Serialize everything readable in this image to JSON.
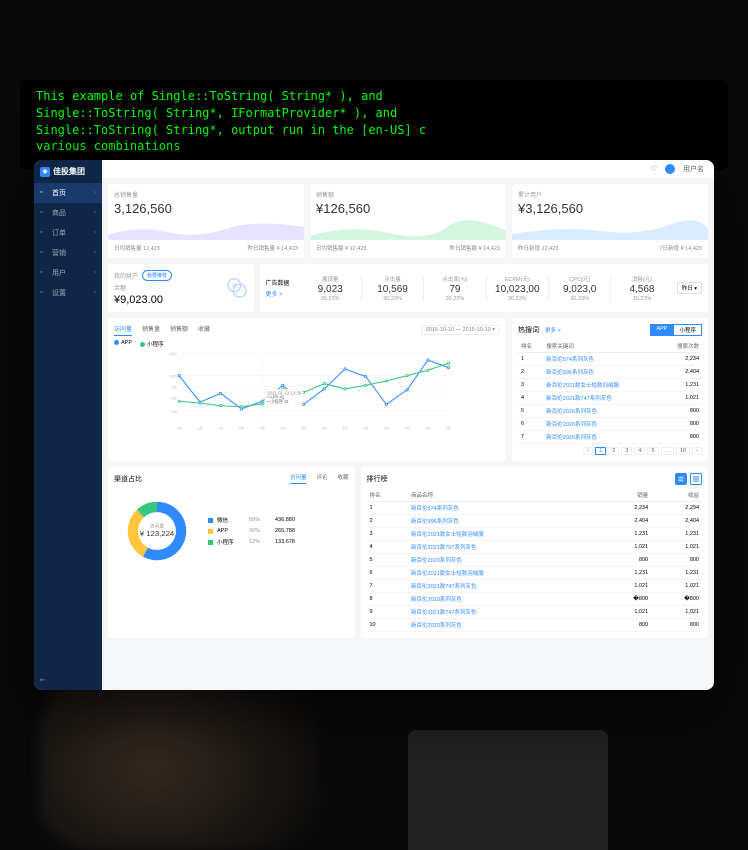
{
  "terminal": {
    "line1": "This example of Single::ToString( String* ), and",
    "line2": "Single::ToString( String*, IFormatProvider* ), and",
    "line3": "Single::ToString( String*, output run in the [en-US] c",
    "line4": "various combinations"
  },
  "brand": "佳投集团",
  "topbar": {
    "user": "用户名"
  },
  "nav": [
    {
      "label": "首页",
      "active": true
    },
    {
      "label": "商品",
      "active": false
    },
    {
      "label": "订单",
      "active": false
    },
    {
      "label": "营销",
      "active": false
    },
    {
      "label": "用户",
      "active": false
    },
    {
      "label": "设置",
      "active": false
    }
  ],
  "kpis": [
    {
      "label": "总销售量",
      "value": "3,126,560",
      "footLeft": "日均销售量 12,423",
      "footRight": "昨日销售量 ¥ 14,423",
      "color": "#e6e2ff"
    },
    {
      "label": "销售额",
      "value": "¥126,560",
      "footLeft": "日均销售额 ¥ 12,423",
      "footRight": "昨日销售额 ¥ 14,423",
      "color": "#d4f5df"
    },
    {
      "label": "累计用户",
      "value": "¥3,126,560",
      "footLeft": "昨日新增 12,423",
      "footRight": "7日新增 ¥ 14,423",
      "color": "#d8ecff"
    }
  ],
  "wallet": {
    "title": "我的财产",
    "btn": "我要推荐",
    "label": "余额",
    "value": "¥9,023.00"
  },
  "ad": {
    "title": "广告数据",
    "more": "更多 >",
    "select": "昨日 ▾",
    "metrics": [
      {
        "name": "展现量",
        "val": "9,023",
        "delta": "30.23%"
      },
      {
        "name": "点击量",
        "val": "10,569",
        "delta": "30.23%"
      },
      {
        "name": "点击率(%)",
        "val": "79",
        "delta": "30.23%"
      },
      {
        "name": "ECPM(元)",
        "val": "10,023,00",
        "delta": "30.23%"
      },
      {
        "name": "CPC(元)",
        "val": "9,023,0",
        "delta": "30.23%"
      },
      {
        "name": "消耗(元)",
        "val": "4,568",
        "delta": "30.23%"
      }
    ]
  },
  "chart": {
    "tabs": [
      "访问量",
      "销售量",
      "销售额",
      "收藏"
    ],
    "dateRange": "2015-10-10 — 2015-10-10 ▾",
    "legend": [
      {
        "name": "APP",
        "color": "#2e8bff"
      },
      {
        "name": "小程序",
        "color": "#32c77c"
      }
    ],
    "tooltip": {
      "date": "2021-01-12 12:30",
      "l1": "APP  42",
      "l2": "小程序  31"
    },
    "chart_data": {
      "type": "line",
      "title": "",
      "xlabel": "",
      "ylabel": "",
      "ylim": [
        0,
        1500
      ],
      "yticks": [
        200,
        500,
        750,
        1000,
        1500
      ],
      "categories": [
        "1月",
        "1月",
        "1月",
        "2月",
        "2月",
        "2月",
        "2月",
        "3月",
        "3月",
        "3月",
        "3月",
        "4月",
        "4月",
        "4月"
      ],
      "series": [
        {
          "name": "APP",
          "color": "#2e8bff",
          "values": [
            1000,
            400,
            600,
            250,
            420,
            780,
            350,
            700,
            1150,
            980,
            350,
            680,
            1350,
            1180
          ]
        },
        {
          "name": "小程序",
          "color": "#32c77c",
          "values": [
            420,
            380,
            320,
            300,
            360,
            700,
            620,
            820,
            700,
            780,
            880,
            1000,
            1120,
            1280
          ]
        }
      ]
    }
  },
  "search": {
    "title": "热搜词",
    "more": "更多 >",
    "segs": [
      "APP",
      "小程序"
    ],
    "cols": [
      "排名",
      "搜索关键词",
      "搜索次数"
    ],
    "rows": [
      {
        "r": "1",
        "k": "新百伦574系列灰色",
        "c": "2,234"
      },
      {
        "r": "2",
        "k": "新百伦996系列灰色",
        "c": "2,404"
      },
      {
        "r": "3",
        "k": "新百伦2021款女士短款羽绒服",
        "c": "1,231"
      },
      {
        "r": "4",
        "k": "新百伦2021款747系列灰色",
        "c": "1,021"
      },
      {
        "r": "5",
        "k": "新百伦2020系列灰色",
        "c": "800"
      },
      {
        "r": "6",
        "k": "新百伦2020系列灰色",
        "c": "800"
      },
      {
        "r": "7",
        "k": "新百伦2020系列灰色",
        "c": "800"
      }
    ],
    "pages": [
      "1",
      "2",
      "3",
      "4",
      "5",
      "…",
      "10"
    ]
  },
  "donut": {
    "title": "渠道占比",
    "tabs": [
      "访问量",
      "评论",
      "收藏"
    ],
    "centerLabel": "访问量",
    "centerValue": "¥ 123,224",
    "legend": [
      {
        "name": "微信",
        "pct": "58%",
        "val": "436,880",
        "color": "#2e8bff"
      },
      {
        "name": "APP",
        "pct": "30%",
        "val": "265,788",
        "color": "#ffc53d"
      },
      {
        "name": "小程序",
        "pct": "12%",
        "val": "133,678",
        "color": "#32c77c"
      }
    ],
    "chart_data": {
      "type": "pie",
      "categories": [
        "微信",
        "APP",
        "小程序"
      ],
      "values": [
        58,
        30,
        12
      ]
    }
  },
  "rank": {
    "title": "排行榜",
    "cols": [
      "排名",
      "商品名称",
      "销量",
      "收益"
    ],
    "rows": [
      {
        "r": "1",
        "n": "新百伦574系列灰色",
        "s": "2,234",
        "p": "2,294"
      },
      {
        "r": "2",
        "n": "新百伦996系列灰色",
        "s": "2,404",
        "p": "2,404"
      },
      {
        "r": "3",
        "n": "新百伦2021款女士短款羽绒服",
        "s": "1,231",
        "p": "1,231"
      },
      {
        "r": "4",
        "n": "新百伦2021款707系列灰色",
        "s": "1,021",
        "p": "1,021"
      },
      {
        "r": "5",
        "n": "新百伦2020系列灰色",
        "s": "800",
        "p": "800"
      },
      {
        "r": "6",
        "n": "新百伦2021款女士短款羽绒服",
        "s": "1,231",
        "p": "1,231"
      },
      {
        "r": "7",
        "n": "新百伦2021款747系列灰色",
        "s": "1,021",
        "p": "1,021"
      },
      {
        "r": "8",
        "n": "新百伦2020系列灰色",
        "s": "�800",
        "p": "�800"
      },
      {
        "r": "9",
        "n": "新百伦2021款747系列灰色",
        "s": "1,021",
        "p": "1,021"
      },
      {
        "r": "10",
        "n": "新百伦2020系列灰色",
        "s": "800",
        "p": "800"
      }
    ]
  }
}
